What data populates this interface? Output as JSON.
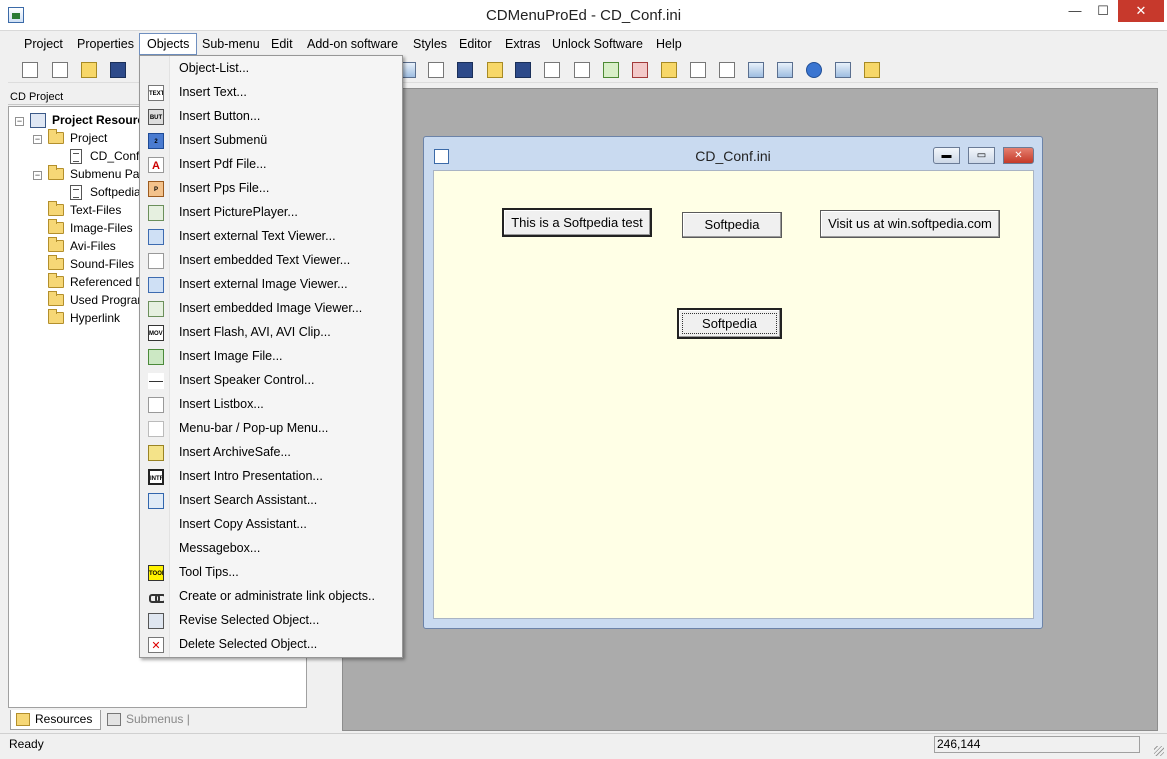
{
  "window": {
    "title": "CDMenuProEd - CD_Conf.ini",
    "minimize_glyph": "—",
    "maximize_glyph": "☐",
    "close_glyph": "✕",
    "close_color": "#c7392c"
  },
  "menubar": {
    "items": [
      "Project",
      "Properties",
      "Objects",
      "Sub-menu",
      "Edit",
      "Add-on software",
      "Styles",
      "Editor",
      "Extras",
      "Unlock Software",
      "Help"
    ],
    "active": "Objects"
  },
  "toolbar": {
    "icons": [
      "magic-wand-icon",
      "new-file-icon",
      "open-folder-icon",
      "save-icon",
      "image-icon",
      "move-arrows-icon",
      "title-icon",
      "speaker-icon",
      "hello-icon",
      "link-icon",
      "rectangle-icon",
      "picture-frame-icon",
      "delete-object-icon",
      "search-icon",
      "paint-icon",
      "cut-icon",
      "copy-icon",
      "paste-icon",
      "help-icon",
      "cube-icon",
      "home-icon"
    ]
  },
  "left_panel": {
    "title": "CD Project",
    "tree": {
      "root": "Project Resourc",
      "project": "Project",
      "project_file": "CD_Conf.",
      "submenu_pages": "Submenu Pa",
      "submenu_file": "Softpedia",
      "text_files": "Text-Files",
      "image_files": "Image-Files",
      "avi_files": "Avi-Files",
      "sound_files": "Sound-Files",
      "referenced": "Referenced D",
      "used_programs": "Used Prograr",
      "hyperlink": "Hyperlink"
    },
    "tabs": {
      "resources": "Resources",
      "submenus": "Submenus |"
    }
  },
  "objects_menu": {
    "items": [
      {
        "label": "Object-List...",
        "icon": ""
      },
      {
        "label": "Insert Text...",
        "icon": "TEXT"
      },
      {
        "label": "Insert Button...",
        "icon": "BUT"
      },
      {
        "label": "Insert Submenü",
        "icon": "2"
      },
      {
        "label": "Insert Pdf File...",
        "icon": "A"
      },
      {
        "label": "Insert Pps File...",
        "icon": "P"
      },
      {
        "label": "Insert PicturePlayer...",
        "icon": ""
      },
      {
        "label": "Insert external Text Viewer...",
        "icon": ""
      },
      {
        "label": "Insert embedded Text Viewer...",
        "icon": ""
      },
      {
        "label": "Insert external Image Viewer...",
        "icon": ""
      },
      {
        "label": "Insert embedded Image Viewer...",
        "icon": ""
      },
      {
        "label": "Insert Flash, AVI, AVI Clip...",
        "icon": "MOVI"
      },
      {
        "label": "Insert Image File...",
        "icon": ""
      },
      {
        "label": "Insert Speaker Control...",
        "icon": ""
      },
      {
        "label": "Insert Listbox...",
        "icon": ""
      },
      {
        "label": "Menu-bar / Pop-up Menu...",
        "icon": ""
      },
      {
        "label": "Insert ArchiveSafe...",
        "icon": ""
      },
      {
        "label": "Insert Intro Presentation...",
        "icon": "INTRO"
      },
      {
        "label": "Insert Search Assistant...",
        "icon": ""
      },
      {
        "label": "Insert Copy Assistant...",
        "icon": ""
      },
      {
        "label": "Messagebox...",
        "icon": ""
      },
      {
        "label": "Tool Tips...",
        "icon": "TOOL TIP"
      },
      {
        "label": "Create or administrate link objects..",
        "icon": ""
      },
      {
        "label": "Revise Selected Object...",
        "icon": ""
      },
      {
        "label": "Delete Selected Object...",
        "icon": "✕"
      }
    ]
  },
  "child_window": {
    "title": "CD_Conf.ini",
    "minimize_glyph": "▬",
    "maximize_glyph": "▭",
    "close_glyph": "✕",
    "background_color": "#ffffe6",
    "buttons": {
      "button1": "This is a Softpedia test",
      "button2": "Softpedia",
      "button3": "Visit us at win.softpedia.com",
      "button4": "Softpedia"
    }
  },
  "statusbar": {
    "text": "Ready",
    "coords": "246,144"
  }
}
